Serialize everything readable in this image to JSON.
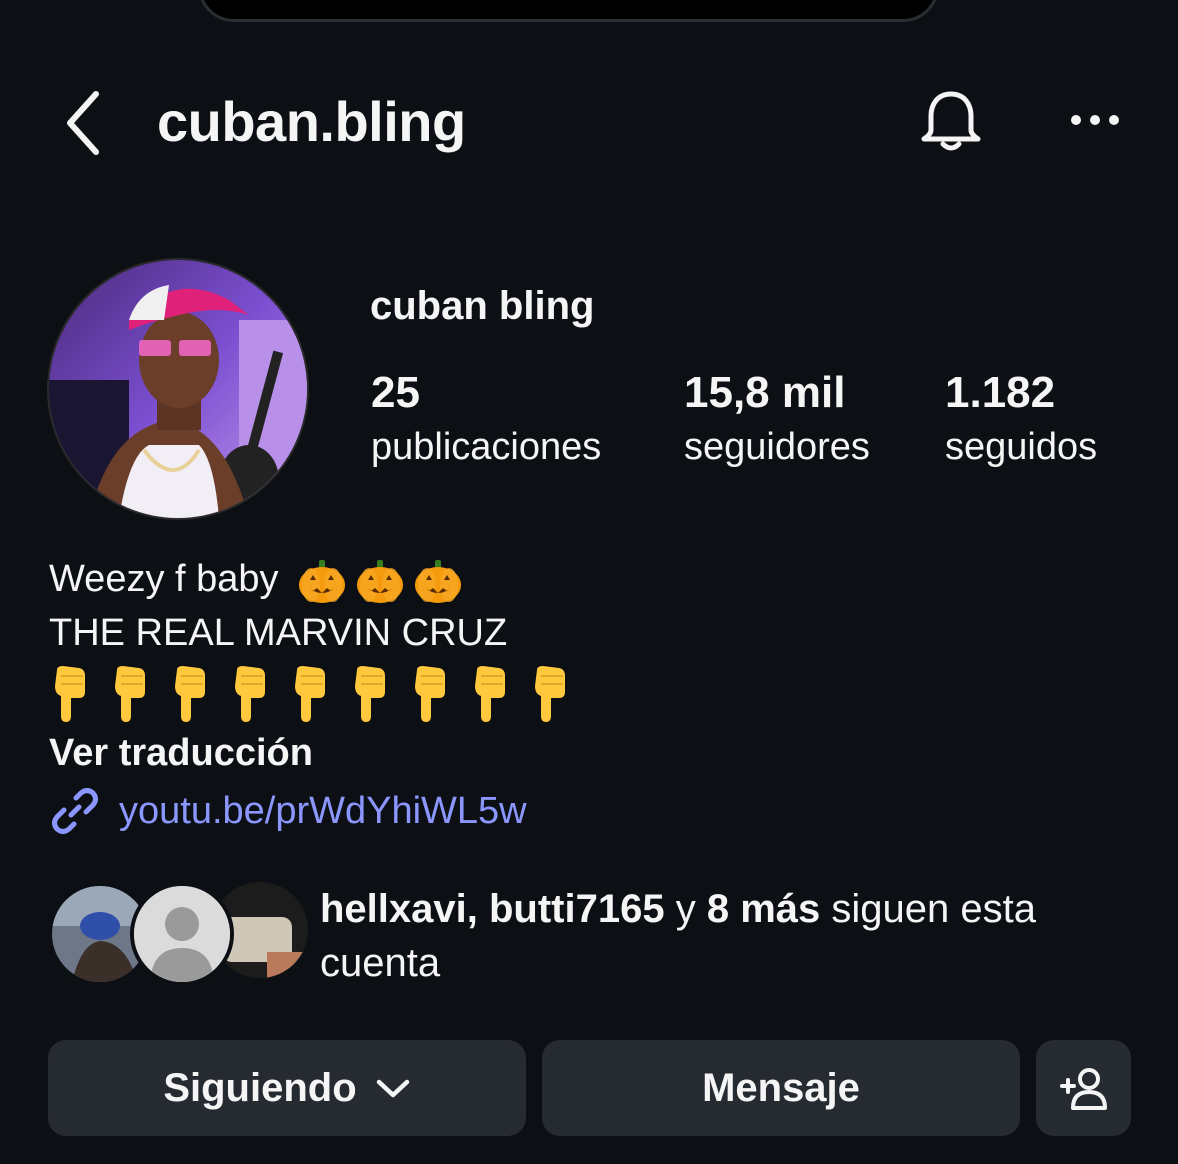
{
  "header": {
    "username": "cuban.bling",
    "back_icon": "chevron-left-icon",
    "bell_icon": "bell-icon",
    "more_icon": "more-horizontal-icon"
  },
  "profile": {
    "display_name": "cuban bling",
    "stats": [
      {
        "value": "25",
        "label": "publicaciones"
      },
      {
        "value": "15,8 mil",
        "label": "seguidores"
      },
      {
        "value": "1.182",
        "label": "seguidos"
      }
    ]
  },
  "bio": {
    "line1": "Weezy f baby",
    "line1_emoji": "pumpkin",
    "line1_emoji_count": 3,
    "line2": "THE REAL MARVIN CRUZ",
    "line3_emoji": "pointing-down-hand",
    "line3_emoji_count": 9,
    "translate_label": "Ver traducción",
    "link_text": "youtu.be/prWdYhiWL5w"
  },
  "followed_by": {
    "names": "hellxavi, butti7165",
    "connector": " y ",
    "more": "8 más",
    "suffix": " siguen esta cuenta"
  },
  "actions": {
    "following_label": "Siguiendo",
    "message_label": "Mensaje",
    "add_user_icon": "add-user-icon"
  },
  "colors": {
    "background": "#0c1014",
    "button": "#262a31",
    "link": "#8b97ff"
  }
}
